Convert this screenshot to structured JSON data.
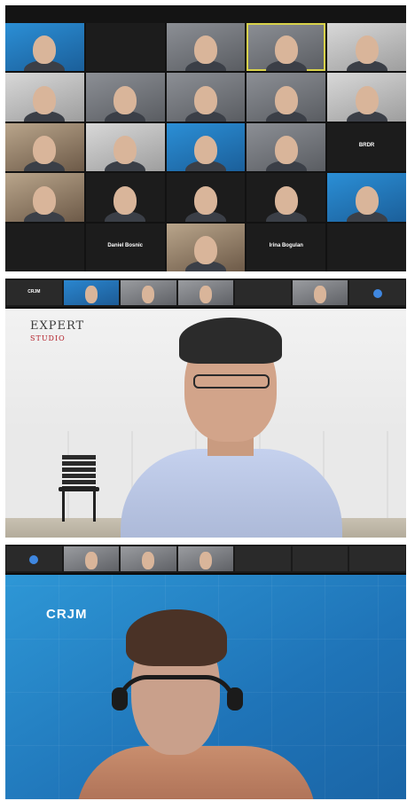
{
  "panel1": {
    "tiles": [
      {
        "style": "blue",
        "person": true,
        "name": ""
      },
      {
        "style": "dark",
        "person": false,
        "name": ""
      },
      {
        "style": "video",
        "person": true,
        "name": ""
      },
      {
        "style": "video",
        "person": true,
        "name": "",
        "active": true
      },
      {
        "style": "light",
        "person": true,
        "name": ""
      },
      {
        "style": "light",
        "person": true,
        "name": ""
      },
      {
        "style": "video",
        "person": true,
        "name": ""
      },
      {
        "style": "video",
        "person": true,
        "name": ""
      },
      {
        "style": "video",
        "person": true,
        "name": ""
      },
      {
        "style": "light",
        "person": true,
        "name": ""
      },
      {
        "style": "warm",
        "person": true,
        "name": ""
      },
      {
        "style": "light",
        "person": true,
        "name": ""
      },
      {
        "style": "blue",
        "person": true,
        "name": ""
      },
      {
        "style": "video",
        "person": true,
        "name": ""
      },
      {
        "style": "dark",
        "person": false,
        "name": "",
        "label": "BRDR"
      },
      {
        "style": "warm",
        "person": true,
        "name": ""
      },
      {
        "style": "dark",
        "person": true,
        "name": ""
      },
      {
        "style": "dark",
        "person": true,
        "name": ""
      },
      {
        "style": "dark",
        "person": true,
        "name": ""
      },
      {
        "style": "blue",
        "person": true,
        "name": ""
      },
      {
        "style": "dark",
        "person": false,
        "name": ""
      },
      {
        "style": "dark",
        "person": false,
        "name": "",
        "label": "Daniel Bosnic"
      },
      {
        "style": "warm",
        "person": true,
        "name": ""
      },
      {
        "style": "dark",
        "person": false,
        "name": "",
        "label": "Irina Bogulan"
      },
      {
        "style": "dark",
        "person": false,
        "name": ""
      }
    ]
  },
  "panel2": {
    "strip": [
      {
        "style": "dark",
        "label": "CRJM",
        "kind": "text"
      },
      {
        "style": "blue",
        "kind": "person"
      },
      {
        "style": "video",
        "kind": "person"
      },
      {
        "style": "video",
        "kind": "person"
      },
      {
        "style": "dark",
        "label": "",
        "kind": "text"
      },
      {
        "style": "video",
        "kind": "person"
      },
      {
        "style": "dark",
        "kind": "dot"
      }
    ],
    "logo_line1": "EXPERT",
    "logo_line2": "STUDIO"
  },
  "panel3": {
    "strip": [
      {
        "style": "dark",
        "kind": "dot"
      },
      {
        "style": "video",
        "kind": "person"
      },
      {
        "style": "video",
        "kind": "person"
      },
      {
        "style": "video",
        "kind": "person"
      },
      {
        "style": "dark",
        "label": "",
        "kind": "text"
      },
      {
        "style": "dark",
        "label": "",
        "kind": "text"
      },
      {
        "style": "dark",
        "label": "",
        "kind": "text"
      }
    ],
    "logo_line1": "CRJM",
    "logo_line2": ""
  }
}
